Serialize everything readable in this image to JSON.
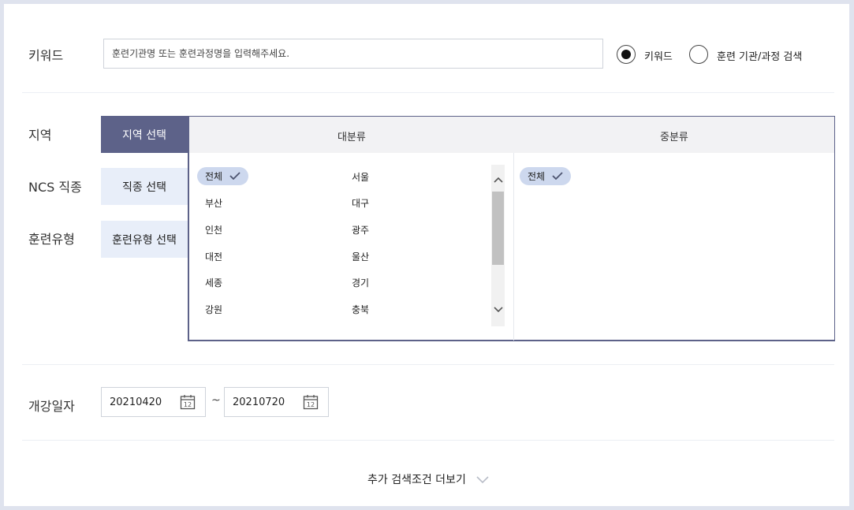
{
  "keyword": {
    "label": "키워드",
    "placeholder": "훈련기관명 또는 훈련과정명을 입력해주세요.",
    "radio_options": [
      {
        "label": "키워드",
        "checked": true
      },
      {
        "label": "훈련 기관/과정 검색",
        "checked": false
      }
    ]
  },
  "filters": {
    "region_label": "지역",
    "ncs_label": "NCS 직종",
    "training_type_label": "훈련유형",
    "region_button": "지역 선택",
    "ncs_button": "직종 선택",
    "training_type_button": "훈련유형 선택"
  },
  "region_panel": {
    "major_header": "대분류",
    "minor_header": "중분류",
    "major_items": [
      "전체",
      "서울",
      "부산",
      "대구",
      "인천",
      "광주",
      "대전",
      "울산",
      "세종",
      "경기",
      "강원",
      "충북"
    ],
    "selected_major": "전체",
    "minor_items": [
      "전체"
    ],
    "selected_minor": "전체"
  },
  "dates": {
    "label": "개강일자",
    "start": "20210420",
    "end": "20210720",
    "separator": "~",
    "calendar_icon_text": "12"
  },
  "more_search": {
    "label": "추가 검색조건 더보기"
  },
  "colors": {
    "accent": "#5d6289",
    "button_bg": "#e8eef9",
    "chip_bg": "#cdd8ee",
    "page_border": "#dfe3ee"
  },
  "icons": [
    "check-icon",
    "calendar-icon",
    "chevron-down-icon",
    "scroll-up-icon",
    "scroll-down-icon"
  ]
}
